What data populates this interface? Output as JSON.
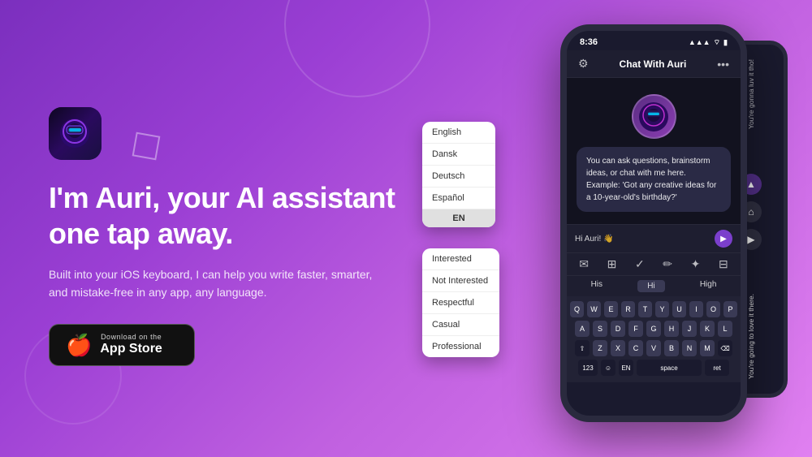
{
  "background": {
    "gradient_start": "#7B2FBE",
    "gradient_end": "#E080F0"
  },
  "hero": {
    "headline": "I'm Auri, your AI assistant\none tap away.",
    "subtext": "Built into your iOS keyboard, I can help you write faster, smarter, and mistake-free in any app, any language.",
    "app_store_badge": {
      "small_text": "Download on the",
      "large_text": "App Store"
    }
  },
  "phone": {
    "status_bar": {
      "time": "8:36",
      "signal": "●●●",
      "wifi": "wifi",
      "battery": "battery"
    },
    "header": {
      "title": "Chat With Auri",
      "left_icon": "gear",
      "right_icon": "more"
    },
    "chat": {
      "bubble_text": "You can ask questions, brainstorm ideas, or chat with me here. Example: 'Got any creative ideas for a 10-year-old's birthday?'",
      "input_placeholder": "Hi Auri! 👋"
    },
    "word_suggestions": [
      "His",
      "Hi",
      "High"
    ],
    "active_suggestion": "Hi",
    "keyboard_rows": [
      [
        "Q",
        "W",
        "E",
        "R",
        "T",
        "Y",
        "U",
        "I",
        "O",
        "P"
      ],
      [
        "A",
        "S",
        "D",
        "F",
        "G",
        "H",
        "J",
        "K",
        "L"
      ],
      [
        "Z",
        "X",
        "C",
        "V",
        "B",
        "N",
        "M"
      ]
    ],
    "bottom_row": [
      "123",
      "🌐",
      "EN",
      "space",
      "return"
    ]
  },
  "lang_options": [
    "English",
    "Dansk",
    "Deutsch",
    "Español"
  ],
  "lang_badge": "EN",
  "tone_options": [
    "Interested",
    "Not Interested",
    "Respectful",
    "Casual",
    "Professional"
  ],
  "side_phone": {
    "text1": "You're gonna luv it tho!",
    "text2": "You're going to love it there."
  }
}
